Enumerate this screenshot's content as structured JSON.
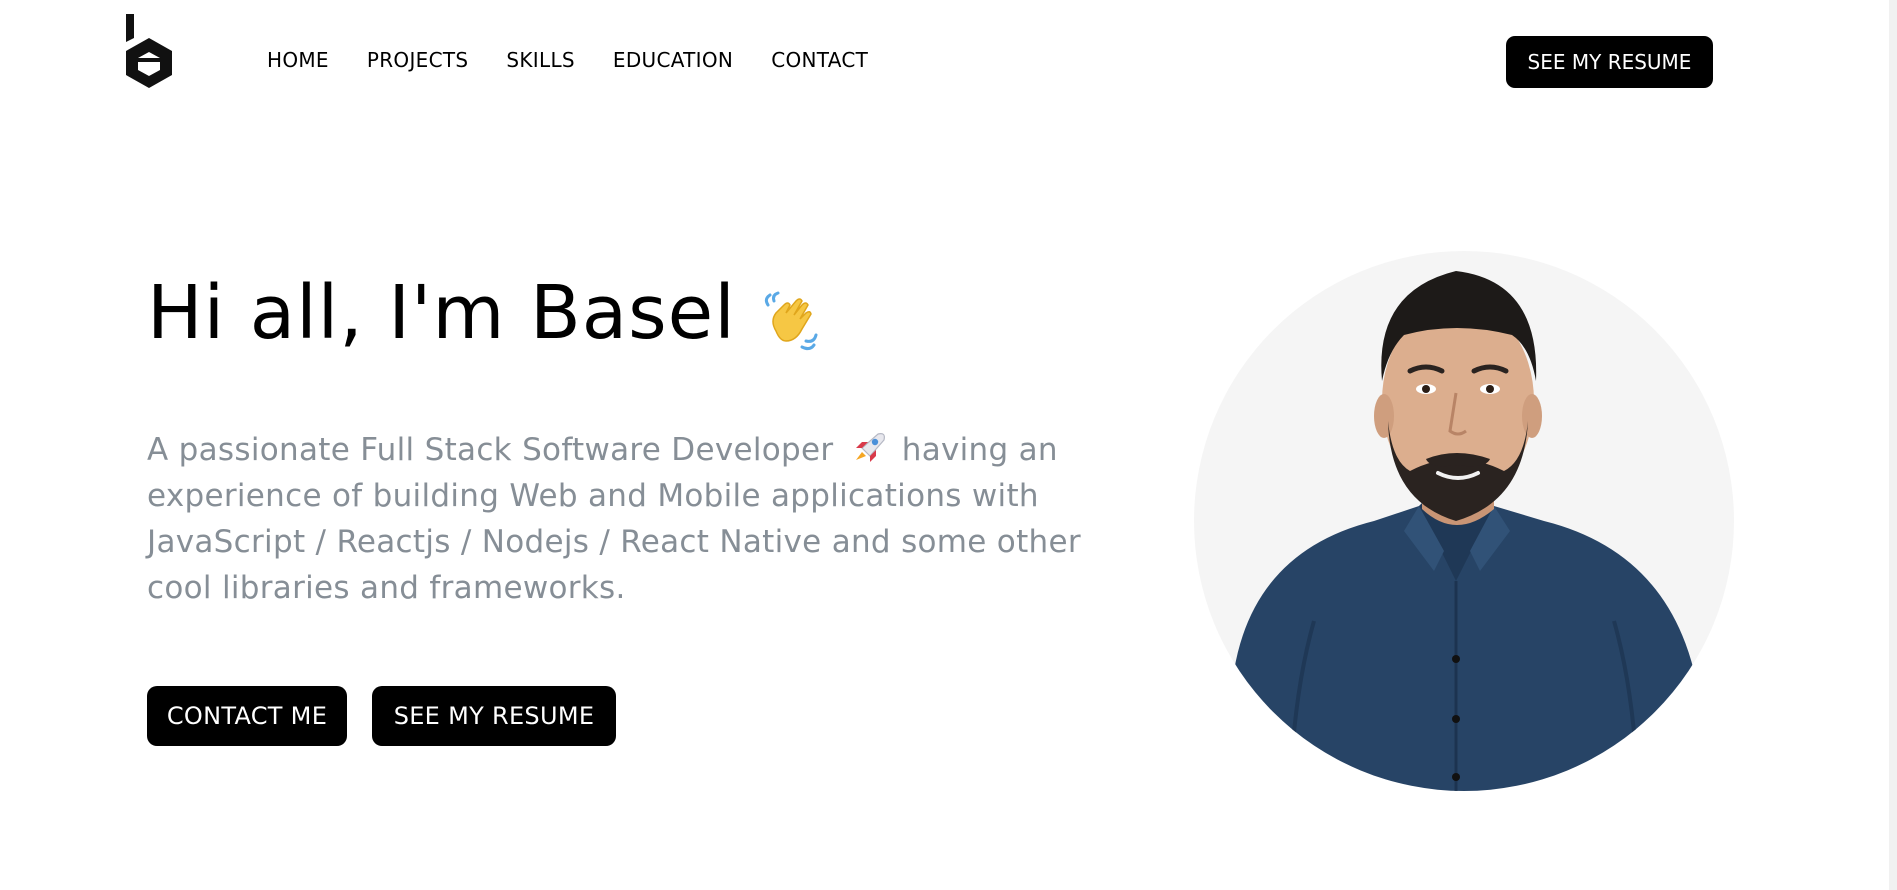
{
  "header": {
    "logo_icon": "b-hexagon-logo-icon",
    "nav": [
      {
        "label": "HOME"
      },
      {
        "label": "PROJECTS"
      },
      {
        "label": "SKILLS"
      },
      {
        "label": "EDUCATION"
      },
      {
        "label": "CONTACT"
      }
    ],
    "resume_label": "SEE MY RESUME"
  },
  "hero": {
    "title": "Hi all, I'm Basel",
    "title_icon": "waving-hand-icon",
    "desc_before": "A passionate Full Stack Software Developer",
    "desc_icon": "rocket-icon",
    "desc_after": "having an experience of building Web and Mobile applications with JavaScript / Reactjs / Nodejs / React Native and some other cool libraries and frameworks.",
    "contact_label": "CONTACT ME",
    "resume_label": "SEE MY RESUME",
    "portrait": "profile-photo"
  },
  "colors": {
    "text": "#000000",
    "muted": "#868e96",
    "button_bg": "#000000",
    "button_text": "#ffffff",
    "portrait_bg": "#f5f5f5",
    "shirt": "#274466"
  }
}
